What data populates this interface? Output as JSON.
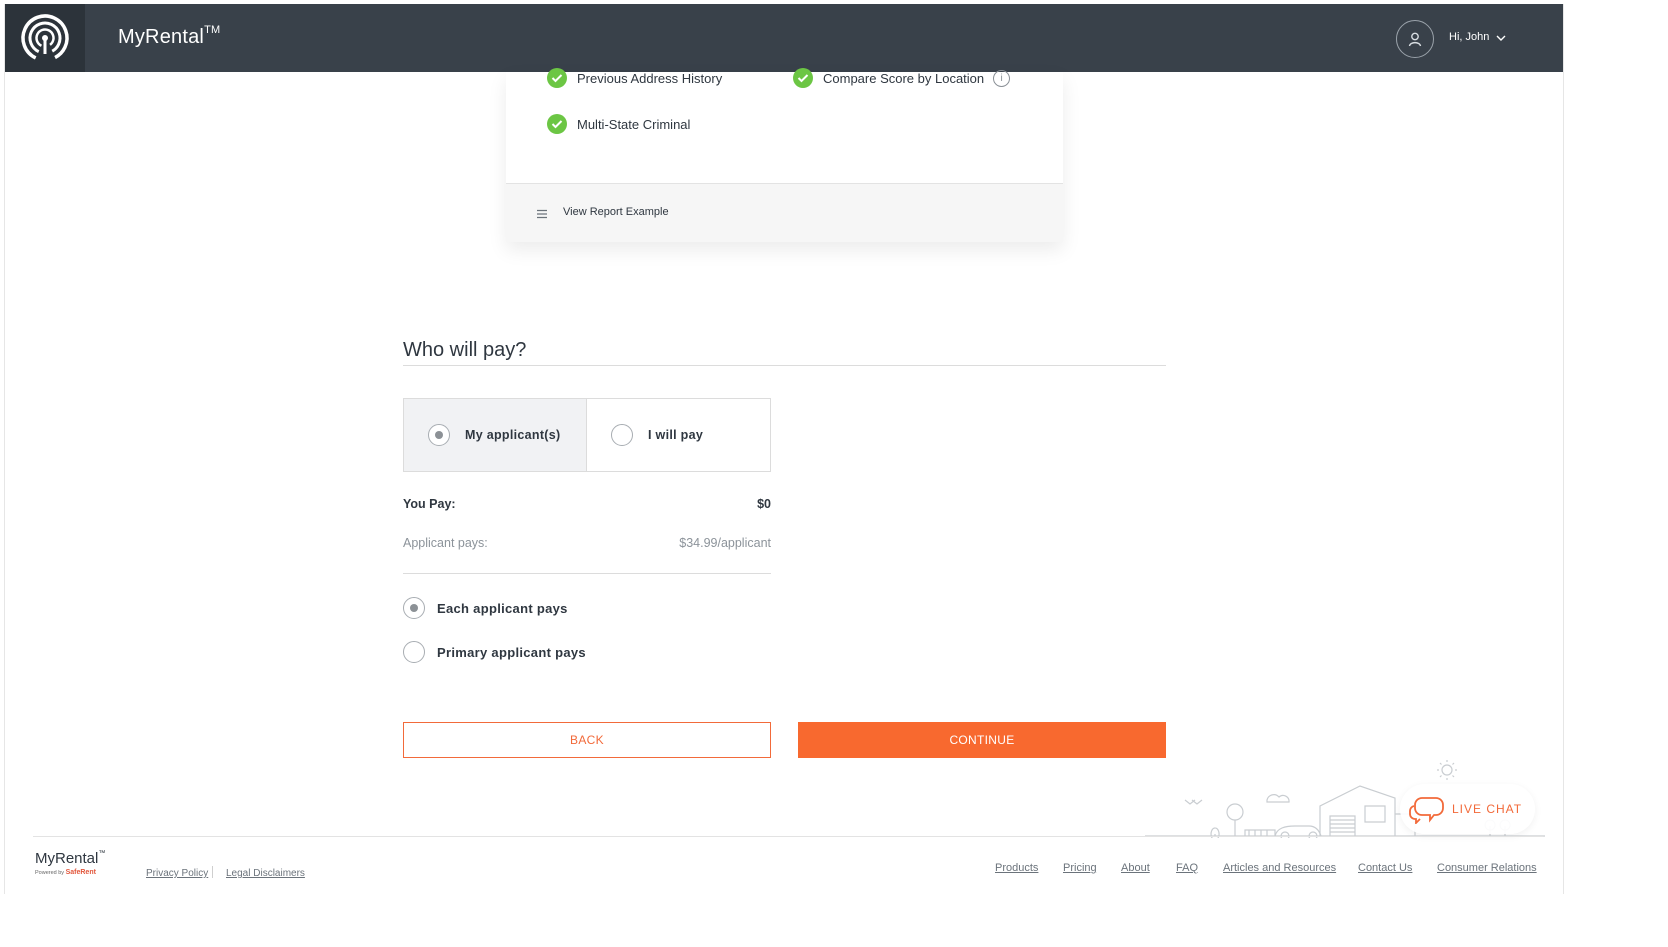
{
  "header": {
    "brand": "MyRental",
    "brand_mark": "TM",
    "greeting": "Hi, John",
    "icons": {
      "logo": "signal-logo-icon",
      "avatar": "user-icon",
      "dropdown": "chevron-down-icon"
    }
  },
  "report_card": {
    "features": [
      "Previous Address History",
      "Compare Score by Location",
      "Multi-State Criminal"
    ],
    "view_report": "View Report Example"
  },
  "payment": {
    "title": "Who will pay?",
    "options": [
      "My applicant(s)",
      "I will pay"
    ],
    "selected_option": "My applicant(s)",
    "you_pay_label": "You Pay:",
    "you_pay_value": "$0",
    "applicant_pays_label": "Applicant pays:",
    "applicant_pays_value": "$34.99/applicant",
    "split_options": [
      "Each applicant pays",
      "Primary applicant pays"
    ],
    "selected_split": "Each applicant pays"
  },
  "actions": {
    "back": "BACK",
    "continue": "CONTINUE"
  },
  "footer": {
    "brand": "MyRental",
    "powered_by": "Powered by",
    "powered_brand": "SafeRent",
    "legal_links": [
      "Privacy Policy",
      "Legal Disclaimers"
    ],
    "nav_links": [
      "Products",
      "Pricing",
      "About",
      "FAQ",
      "Articles and Resources",
      "Contact Us",
      "Consumer Relations"
    ]
  },
  "live_chat": "LIVE CHAT",
  "colors": {
    "header": "#39414a",
    "accent": "#f8692f",
    "check": "#6cc644"
  }
}
